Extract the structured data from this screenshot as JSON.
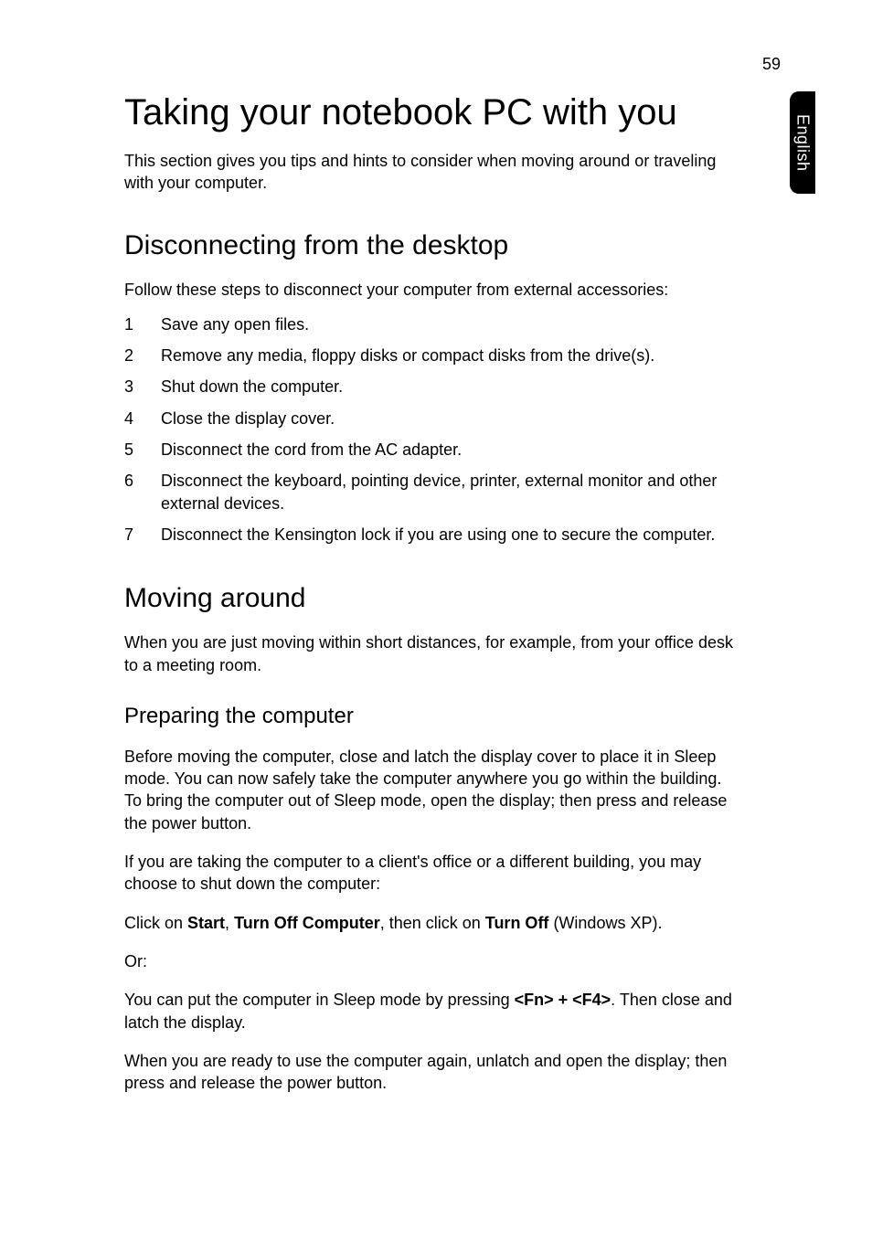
{
  "page_number": "59",
  "side_tab": "English",
  "h1": "Taking your notebook PC with you",
  "intro": "This section gives you tips and hints to consider when moving around or traveling with your computer.",
  "section1": {
    "heading": "Disconnecting from the desktop",
    "lead": "Follow these steps to disconnect your computer from external accessories:",
    "steps": [
      {
        "n": "1",
        "t": "Save any open files."
      },
      {
        "n": "2",
        "t": "Remove any media, floppy disks or compact disks from the drive(s)."
      },
      {
        "n": "3",
        "t": "Shut down the computer."
      },
      {
        "n": "4",
        "t": "Close the display cover."
      },
      {
        "n": "5",
        "t": "Disconnect the cord from the AC adapter."
      },
      {
        "n": "6",
        "t": "Disconnect the keyboard, pointing device, printer, external monitor and other external devices."
      },
      {
        "n": "7",
        "t": "Disconnect the Kensington lock if you are using one to secure the computer."
      }
    ]
  },
  "section2": {
    "heading": "Moving around",
    "lead": "When you are just moving within short distances, for example, from your office desk to a meeting room.",
    "sub_heading": "Preparing the computer",
    "p1": "Before moving the computer, close and latch the display cover to place it in Sleep mode. You can now safely take the computer anywhere you go within the building. To bring the computer out of Sleep mode, open the display; then press and release the power button.",
    "p2": "If you are taking the computer to a client's office or a different building, you may choose to shut down the computer:",
    "p3_pre": "Click on ",
    "p3_b1": "Start",
    "p3_mid1": ", ",
    "p3_b2": "Turn Off Computer",
    "p3_mid2": ", then click on ",
    "p3_b3": "Turn Off",
    "p3_post": " (Windows XP).",
    "p4": "Or:",
    "p5_pre": "You can put the computer in Sleep mode by pressing ",
    "p5_b1": "<Fn> + <F4>",
    "p5_post": ". Then close and latch the display.",
    "p6": "When you are ready to use the computer again, unlatch and open the display; then press and release the power button."
  }
}
